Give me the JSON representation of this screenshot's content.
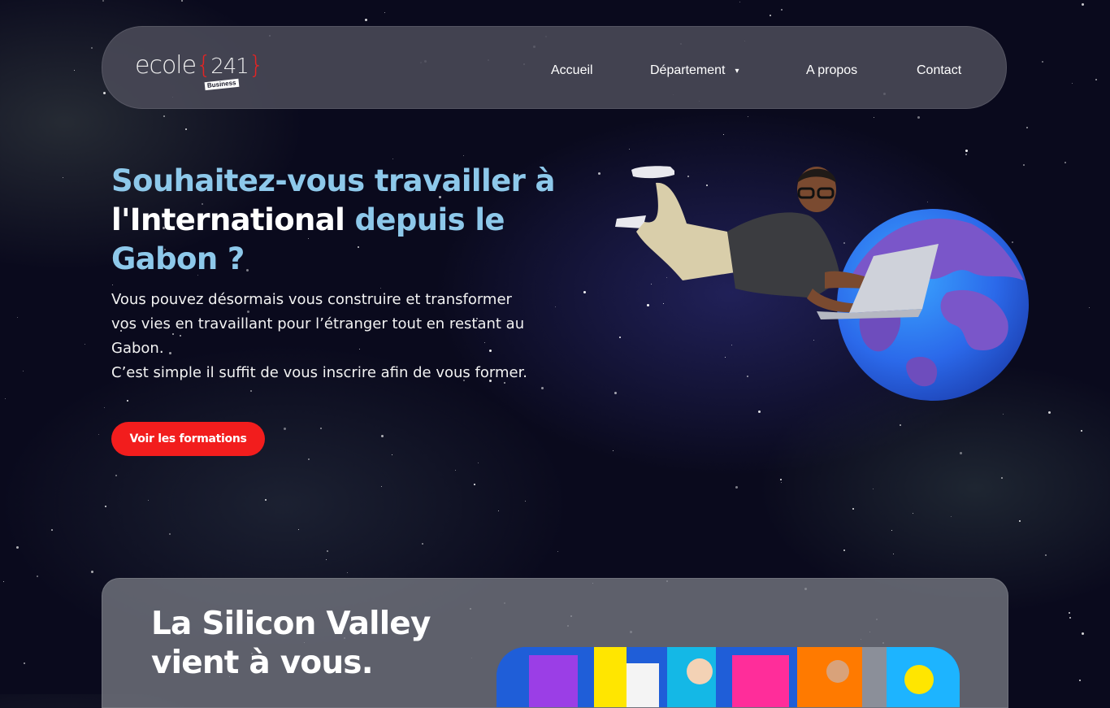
{
  "nav": {
    "logo": {
      "word": "ecole",
      "brace_open": "{",
      "number": "241",
      "brace_close": "}",
      "badge": "Business"
    },
    "links": [
      "Accueil",
      "Département",
      "A propos",
      "Contact"
    ],
    "dropdown_indicator": "▾"
  },
  "hero": {
    "title_parts": [
      "Souhaitez-vous travailler",
      "à",
      "l'International",
      "depuis le",
      "Gabon ?"
    ],
    "paragraph_1": "Vous pouvez désormais vous construire et transformer vos vies en travaillant pour l’étranger tout en restant au Gabon.",
    "paragraph_2": "C’est simple il suffit de vous inscrire afin de vous former.",
    "cta_label": "Voir les formations"
  },
  "section": {
    "title_line_1": "La Silicon Valley",
    "title_line_2": "vient à vous."
  },
  "colors": {
    "accent_blue": "#8dc8ea",
    "cta_red": "#f21d1d",
    "background": "#0a0a1d",
    "nav_bg": "#4a4a58"
  }
}
